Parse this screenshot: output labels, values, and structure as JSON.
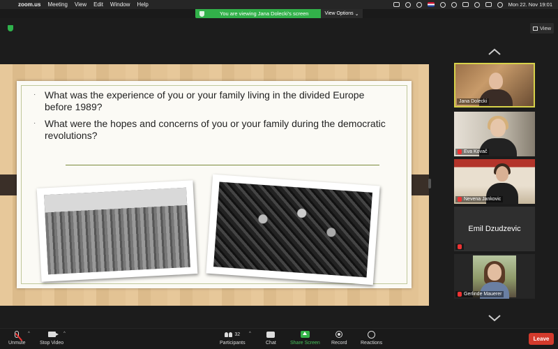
{
  "menubar": {
    "app": "zoom.us",
    "items": [
      "Meeting",
      "View",
      "Edit",
      "Window",
      "Help"
    ],
    "datetime": "Mon 22. Nov  19:01"
  },
  "share_banner": {
    "message": "You are viewing Jana Dolecki's screen",
    "view_options": "View Options"
  },
  "window": {
    "view_button": "View"
  },
  "slide": {
    "bullets": [
      "What was the experience of you or your family living in the divided Europe before 1989?",
      "What were the hopes and concerns of you or your family during the democratic revolutions?"
    ]
  },
  "participants": [
    {
      "name": "Jana Dolecki",
      "muted": false,
      "active": true
    },
    {
      "name": "Eva Kovač",
      "muted": true,
      "active": false
    },
    {
      "name": "Nevena Jankovic",
      "muted": true,
      "active": false
    },
    {
      "name": "Emil Dzudzevic",
      "muted": true,
      "active": false,
      "video_off": true
    },
    {
      "name": "Gerlinde Mauerer",
      "muted": true,
      "active": false
    }
  ],
  "toolbar": {
    "unmute": "Unmute",
    "stop_video": "Stop Video",
    "participants": "Participants",
    "participant_count": "32",
    "chat": "Chat",
    "share_screen": "Share Screen",
    "record": "Record",
    "reactions": "Reactions",
    "leave": "Leave"
  },
  "colors": {
    "share_green": "#32b14a",
    "leave_red": "#d33a2c",
    "active_speaker": "#d7d24a"
  }
}
